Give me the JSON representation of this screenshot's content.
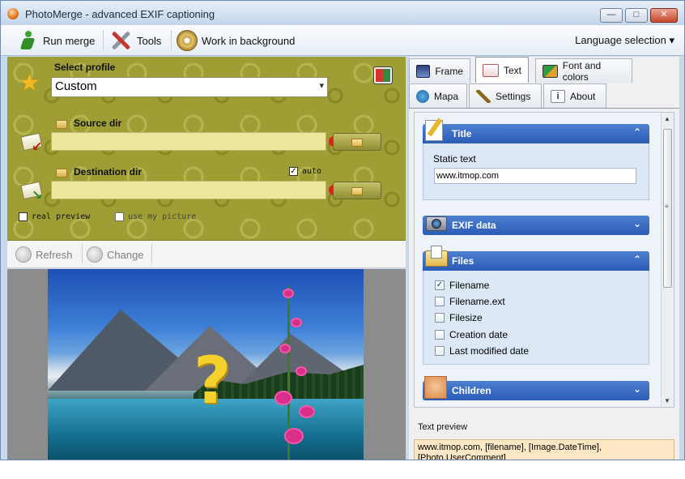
{
  "window": {
    "title": "PhotoMerge - advanced EXIF captioning",
    "controls": [
      "—",
      "□",
      "✕"
    ]
  },
  "toolbar": {
    "run_merge": "Run merge",
    "tools": "Tools",
    "work_bg": "Work in background",
    "language": "Language selection ▾"
  },
  "profile": {
    "label": "Select profile",
    "value": "Custom"
  },
  "source": {
    "label": "Source dir",
    "value": "",
    "error": "!"
  },
  "destination": {
    "label": "Destination dir",
    "value": "",
    "auto_label": "auto",
    "auto_checked": "✓",
    "error": "!"
  },
  "options": {
    "real_preview": "real preview",
    "use_my_picture": "use my picture"
  },
  "preview_toolbar": {
    "refresh": "Refresh",
    "change": "Change"
  },
  "tabs": {
    "frame": "Frame",
    "text": "Text",
    "font_colors": "Font and colors",
    "mapa": "Mapa",
    "settings": "Settings",
    "about": "About",
    "active": "text"
  },
  "sections": {
    "title": {
      "label": "Title",
      "chevron": "⌃",
      "static_text_label": "Static text",
      "static_text_value": "www.itmop.com"
    },
    "exif": {
      "label": "EXIF data",
      "chevron": "⌄"
    },
    "files": {
      "label": "Files",
      "chevron": "⌃",
      "items": [
        {
          "label": "Filename",
          "checked": "✓"
        },
        {
          "label": "Filename.ext",
          "checked": ""
        },
        {
          "label": "Filesize",
          "checked": ""
        },
        {
          "label": "Creation date",
          "checked": ""
        },
        {
          "label": "Last modified date",
          "checked": ""
        }
      ]
    },
    "children": {
      "label": "Children",
      "chevron": "⌄"
    }
  },
  "text_preview": {
    "label": "Text preview",
    "value": "www.itmop.com, [filename], [Image.DateTime], [Photo.UserComment]"
  },
  "preview_image": {
    "overlay": "?"
  },
  "colors": {
    "accent": "#2b5cb6",
    "panel_olive": "#9e9e35",
    "error_red": "#d6261d",
    "preview_bg": "#fde7c4"
  }
}
